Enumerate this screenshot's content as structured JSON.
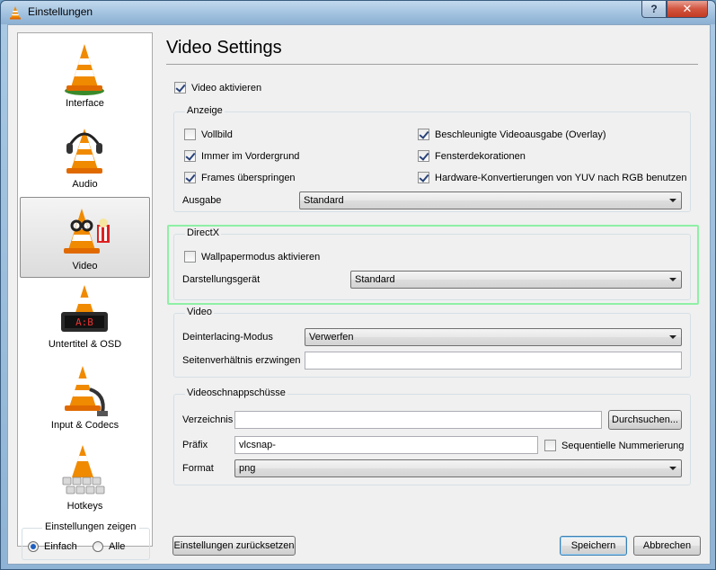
{
  "window": {
    "title": "Einstellungen",
    "help_label": "?",
    "close_label": "✕"
  },
  "sidebar": {
    "items": [
      {
        "label": "Interface",
        "icon": "cone-icon"
      },
      {
        "label": "Audio",
        "icon": "cone-headphones-icon"
      },
      {
        "label": "Video",
        "icon": "cone-glasses-icon",
        "selected": true
      },
      {
        "label": "Untertitel & OSD",
        "icon": "cone-clock-icon"
      },
      {
        "label": "Input & Codecs",
        "icon": "cone-cable-icon"
      },
      {
        "label": "Hotkeys",
        "icon": "cone-keyboard-icon"
      }
    ],
    "show_settings": {
      "title": "Einstellungen zeigen",
      "options": [
        "Einfach",
        "Alle"
      ],
      "selected": "Einfach"
    }
  },
  "main": {
    "title": "Video Settings",
    "enable_video": {
      "label": "Video aktivieren",
      "checked": true
    },
    "display": {
      "title": "Anzeige",
      "options": [
        {
          "label": "Vollbild",
          "checked": false
        },
        {
          "label": "Beschleunigte Videoausgabe (Overlay)",
          "checked": true
        },
        {
          "label": "Immer im Vordergrund",
          "checked": true
        },
        {
          "label": "Fensterdekorationen",
          "checked": true
        },
        {
          "label": "Frames überspringen",
          "checked": true
        },
        {
          "label": "Hardware-Konvertierungen von YUV nach RGB benutzen",
          "checked": true
        }
      ],
      "output_label": "Ausgabe",
      "output_value": "Standard"
    },
    "directx": {
      "title": "DirectX",
      "wallpaper": {
        "label": "Wallpapermodus aktivieren",
        "checked": false
      },
      "device_label": "Darstellungsgerät",
      "device_value": "Standard"
    },
    "video": {
      "title": "Video",
      "deinterlace_label": "Deinterlacing-Modus",
      "deinterlace_value": "Verwerfen",
      "aspect_label": "Seitenverhältnis erzwingen",
      "aspect_value": ""
    },
    "snapshots": {
      "title": "Videoschnappschüsse",
      "directory_label": "Verzeichnis",
      "directory_value": "",
      "browse_label": "Durchsuchen...",
      "prefix_label": "Präfix",
      "prefix_value": "vlcsnap-",
      "sequential": {
        "label": "Sequentielle Nummerierung",
        "checked": false
      },
      "format_label": "Format",
      "format_value": "png"
    }
  },
  "footer": {
    "reset_label": "Einstellungen zurücksetzen",
    "save_label": "Speichern",
    "cancel_label": "Abbrechen"
  },
  "colors": {
    "cone_orange": "#f08a00",
    "highlight_border": "#8ef0a6",
    "accent": "#1f5fbf"
  }
}
